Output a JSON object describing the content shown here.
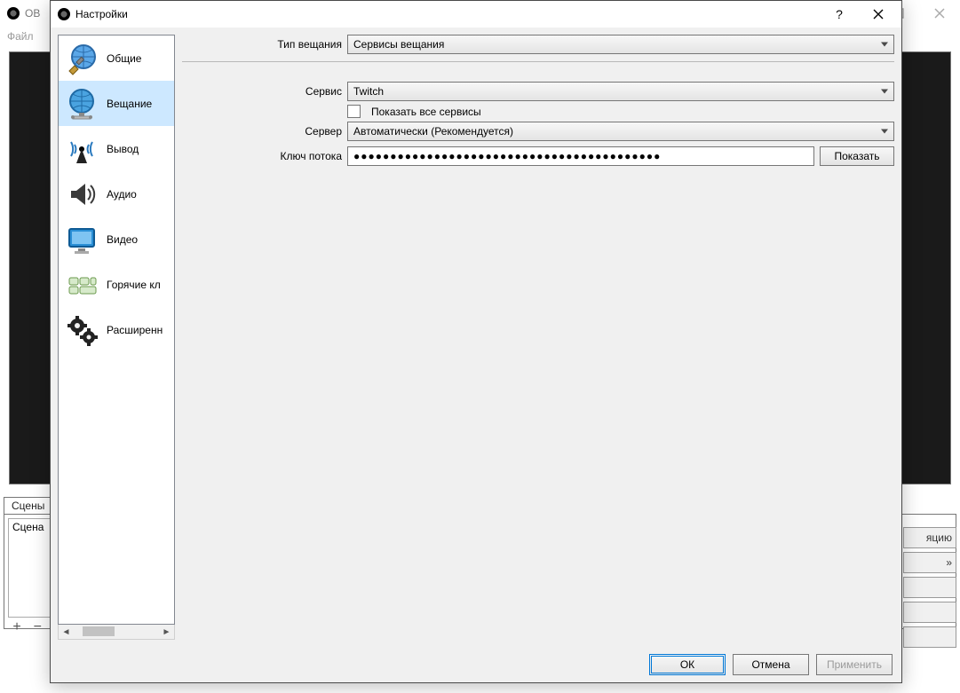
{
  "parent_window": {
    "title_fragment": "OB",
    "menu_file": "Файл",
    "panel_scenes_tab": "Сцены",
    "scene_item": "Сцена",
    "add_btn": "+",
    "remove_btn": "−",
    "right_stub_label": "яцию",
    "right_stub_arrow": "»"
  },
  "dialog": {
    "title": "Настройки",
    "help_tooltip": "?",
    "categories": [
      {
        "id": "general",
        "label": "Общие"
      },
      {
        "id": "stream",
        "label": "Вещание"
      },
      {
        "id": "output",
        "label": "Вывод"
      },
      {
        "id": "audio",
        "label": "Аудио"
      },
      {
        "id": "video",
        "label": "Видео"
      },
      {
        "id": "hotkeys",
        "label": "Горячие кл"
      },
      {
        "id": "advanced",
        "label": "Расширенн"
      }
    ],
    "selected_category": "stream",
    "form": {
      "stream_type_label": "Тип вещания",
      "stream_type_value": "Сервисы вещания",
      "service_label": "Сервис",
      "service_value": "Twitch",
      "show_all_label": "Показать все сервисы",
      "show_all_checked": false,
      "server_label": "Сервер",
      "server_value": "Автоматически (Рекомендуется)",
      "streamkey_label": "Ключ потока",
      "streamkey_mask": "●●●●●●●●●●●●●●●●●●●●●●●●●●●●●●●●●●●●●●●●●●",
      "show_key_btn": "Показать"
    },
    "buttons": {
      "ok": "ОК",
      "cancel": "Отмена",
      "apply": "Применить"
    }
  }
}
